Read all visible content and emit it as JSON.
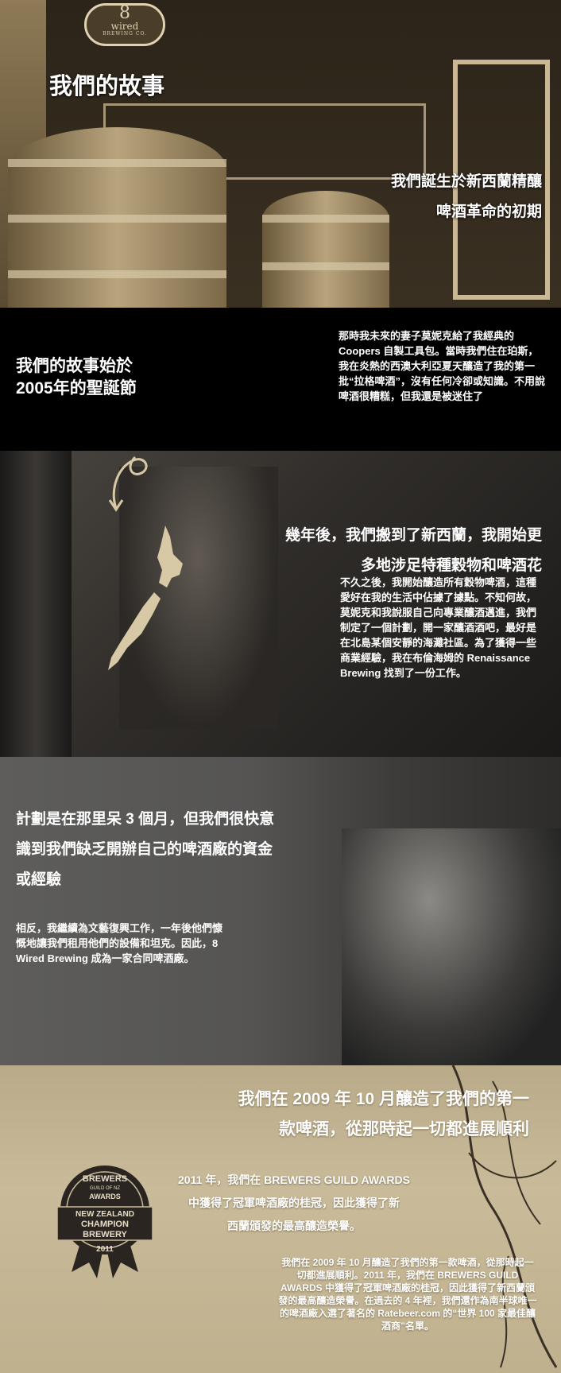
{
  "hero": {
    "logo": {
      "number": "8",
      "word": "wired",
      "caption": "BREWING CO."
    },
    "title": "我們的故事",
    "tagline_line1": "我們誕生於新西蘭精釀",
    "tagline_line2": "啤酒革命的初期"
  },
  "start": {
    "heading_line1": "我們的故事始於",
    "heading_line2": "2005年的聖誕節",
    "paragraph": "那時我未來的妻子莫妮克給了我經典的 Coopers 自製工具包。當時我們住在珀斯，我在炎熱的西澳大利亞夏天釀造了我的第一批“拉格啤酒”，沒有任何冷卻或知識。不用說啤酒很糟糕，但我還是被迷住了"
  },
  "nz": {
    "heading_line1": "幾年後，我們搬到了新西蘭，我開始更",
    "heading_line2": "多地涉足特種穀物和啤酒花",
    "paragraph": "不久之後，我開始釀造所有穀物啤酒，這種愛好在我的生活中佔據了據點。不知何故，莫妮克和我說服自己向專業釀酒邁進，我們制定了一個計劃，開一家釀酒酒吧，最好是在北島某個安靜的海灘社區。為了獲得一些商業經驗，我在布倫海姆的 Renaissance Brewing 找到了一份工作。"
  },
  "plan": {
    "heading_line1": "計劃是在那里呆 3 個月，但我們很快意",
    "heading_line2": "識到我們缺乏開辦自己的啤酒廠的資金",
    "heading_line3": "或經驗",
    "paragraph": "相反，我繼續為文藝復興工作，一年後他們慷慨地讓我們租用他們的設備和坦克。因此，8 Wired Brewing 成為一家合同啤酒廠。"
  },
  "awards": {
    "heading_line1": "我們在 2009 年 10 月釀造了我們的第一",
    "heading_line2": "款啤酒，從那時起一切都進展順利",
    "badge": {
      "top": "BREWERS",
      "sub": "GUILD OF NZ",
      "awards": "AWARDS",
      "line1": "NEW ZEALAND",
      "line2": "CHAMPION",
      "line3": "BREWERY",
      "year": "2011"
    },
    "para1_line1": "2011 年，我們在 BREWERS GUILD AWARDS",
    "para1_line2": "中獲得了冠軍啤酒廠的桂冠，因此獲得了新",
    "para1_line3": "西蘭頒發的最高釀造榮譽。",
    "paragraph2": "我們在 2009 年 10 月釀造了我們的第一款啤酒，從那時起一切都進展順利。2011 年，我們在 BREWERS GUILD AWARDS 中獲得了冠軍啤酒廠的桂冠，因此獲得了新西蘭頒發的最高釀造榮譽。在過去的 4 年裡，我們還作為南半球唯一的啤酒廠入選了著名的 Ratebeer.com 的“世界 100 家最佳釀酒商”名單。"
  }
}
